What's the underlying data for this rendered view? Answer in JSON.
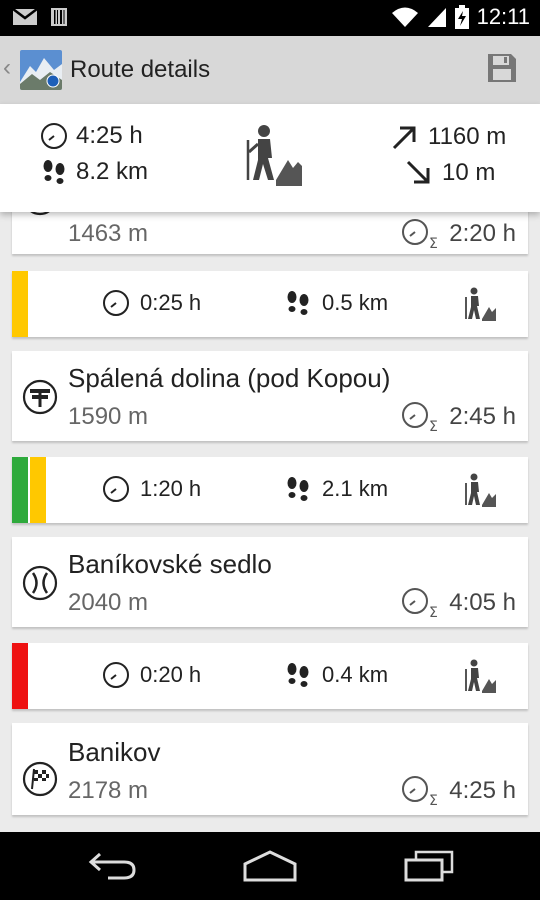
{
  "status_bar": {
    "time": "12:11"
  },
  "action_bar": {
    "back": "‹",
    "title": "Route details"
  },
  "summary": {
    "time": "4:25 h",
    "distance": "8.2 km",
    "ascent": "1160 m",
    "descent": "10 m"
  },
  "points": [
    {
      "name": "",
      "altitude": "1463 m",
      "cumulative_time": "2:20 h",
      "icon": "info-icon"
    },
    {
      "name": "Spálená dolina (pod Kopou)",
      "altitude": "1590 m",
      "cumulative_time": "2:45 h",
      "icon": "signpost-icon"
    },
    {
      "name": "Baníkovské sedlo",
      "altitude": "2040 m",
      "cumulative_time": "4:05 h",
      "icon": "saddle-icon"
    },
    {
      "name": "Banikov",
      "altitude": "2178 m",
      "cumulative_time": "4:25 h",
      "icon": "summit-flag-icon"
    }
  ],
  "segments": [
    {
      "time": "0:25 h",
      "distance": "0.5 km",
      "colors": [
        "#ffc800"
      ]
    },
    {
      "time": "1:20 h",
      "distance": "2.1 km",
      "colors": [
        "#2eaa3c",
        "#ffc800"
      ]
    },
    {
      "time": "0:20 h",
      "distance": "0.4 km",
      "colors": [
        "#ee1111"
      ]
    }
  ],
  "sigma": "Σ"
}
